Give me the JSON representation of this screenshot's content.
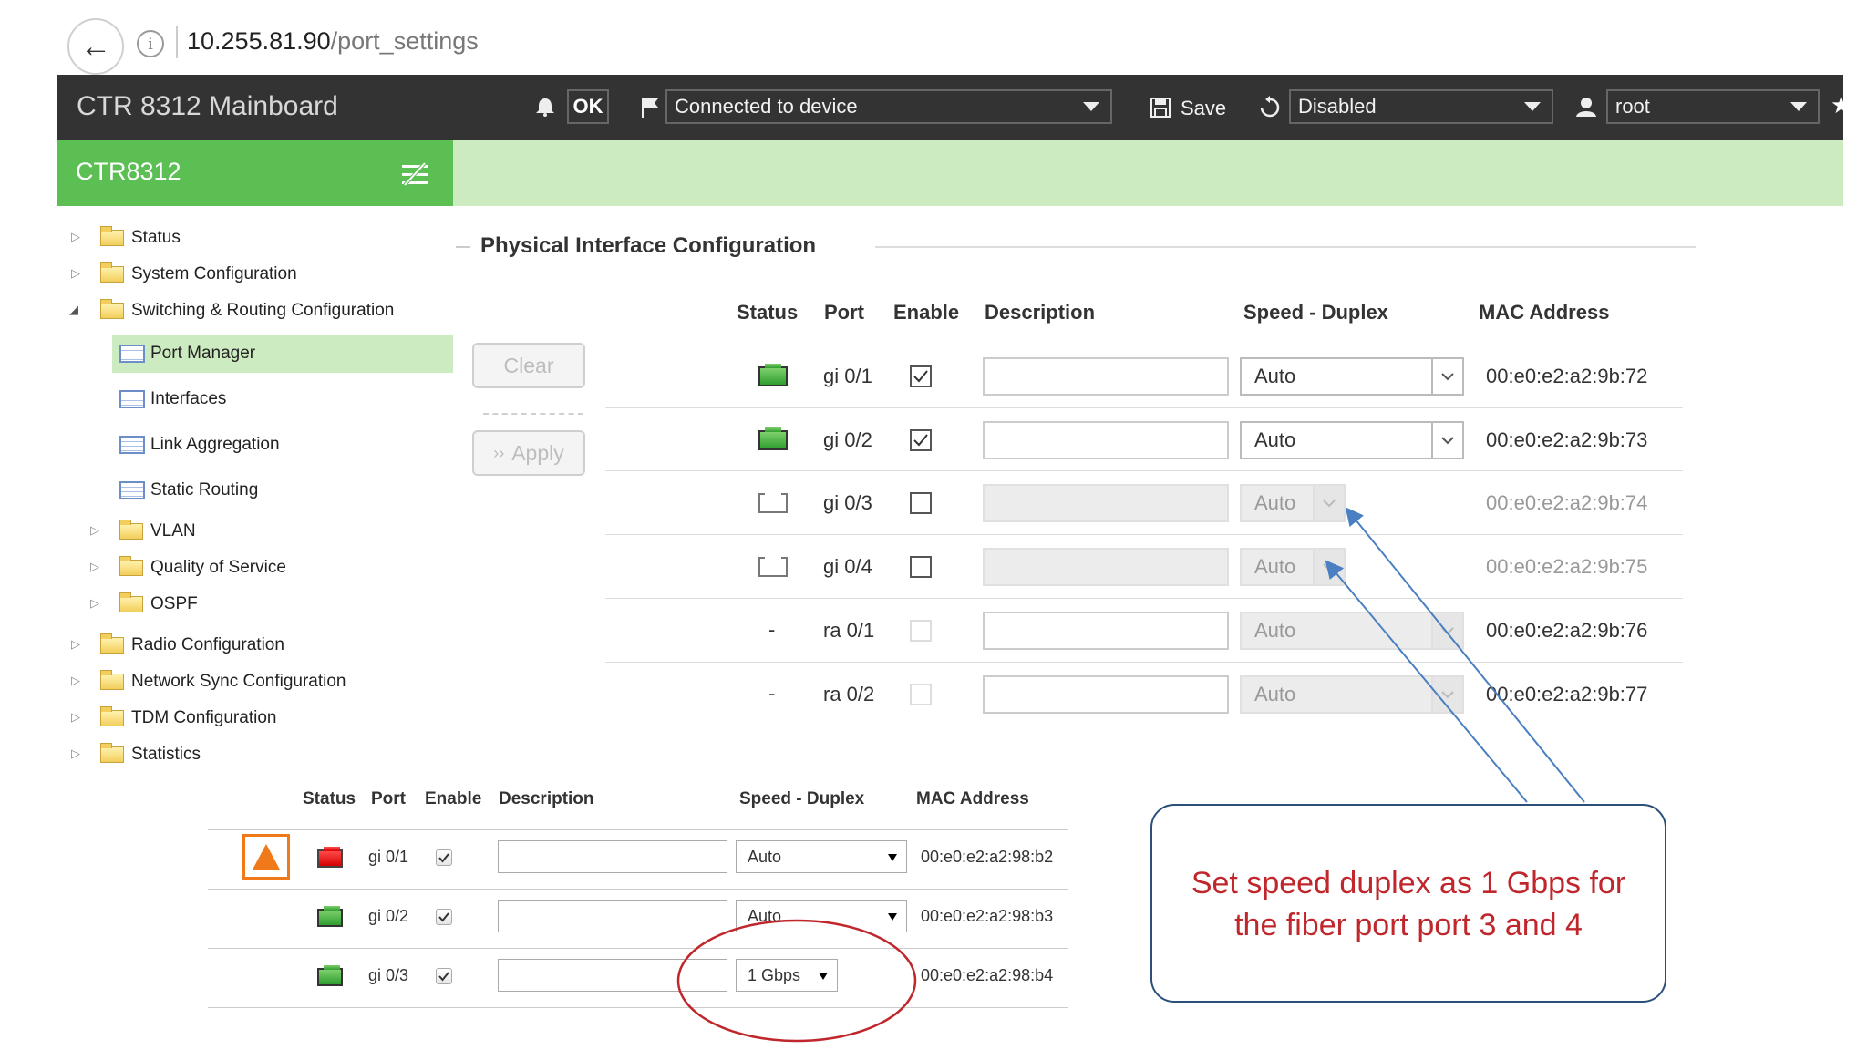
{
  "browser": {
    "url_host": "10.255.81.90",
    "url_path": "/port_settings"
  },
  "header": {
    "title": "CTR 8312 Mainboard",
    "ok_label": "OK",
    "connection_status": "Connected to device",
    "save_label": "Save",
    "auto_refresh": "Disabled",
    "user": "root"
  },
  "sidebar": {
    "title": "CTR8312",
    "items": [
      {
        "label": "Status"
      },
      {
        "label": "System Configuration"
      },
      {
        "label": "Switching & Routing Configuration"
      },
      {
        "label": "Port Manager"
      },
      {
        "label": "Interfaces"
      },
      {
        "label": "Link Aggregation"
      },
      {
        "label": "Static Routing"
      },
      {
        "label": "VLAN"
      },
      {
        "label": "Quality of Service"
      },
      {
        "label": "OSPF"
      },
      {
        "label": "Radio Configuration"
      },
      {
        "label": "Network Sync Configuration"
      },
      {
        "label": "TDM Configuration"
      },
      {
        "label": "Statistics"
      }
    ]
  },
  "main": {
    "section_title": "Physical Interface Configuration",
    "clear_label": "Clear",
    "apply_label": "Apply",
    "columns": [
      "Status",
      "Port",
      "Enable",
      "Description",
      "Speed - Duplex",
      "MAC Address"
    ],
    "rows": [
      {
        "status": "up",
        "status_text": "",
        "port": "gi 0/1",
        "enabled": true,
        "speed": "Auto",
        "mac": "00:e0:e2:a2:9b:72"
      },
      {
        "status": "up",
        "status_text": "",
        "port": "gi 0/2",
        "enabled": true,
        "speed": "Auto",
        "mac": "00:e0:e2:a2:9b:73"
      },
      {
        "status": "off",
        "status_text": "",
        "port": "gi 0/3",
        "enabled": false,
        "speed": "Auto",
        "mac": "00:e0:e2:a2:9b:74"
      },
      {
        "status": "off",
        "status_text": "",
        "port": "gi 0/4",
        "enabled": false,
        "speed": "Auto",
        "mac": "00:e0:e2:a2:9b:75"
      },
      {
        "status": "none",
        "status_text": "-",
        "port": "ra 0/1",
        "enabled": false,
        "speed": "Auto",
        "mac": "00:e0:e2:a2:9b:76"
      },
      {
        "status": "none",
        "status_text": "-",
        "port": "ra 0/2",
        "enabled": false,
        "speed": "Auto",
        "mac": "00:e0:e2:a2:9b:77"
      }
    ]
  },
  "inset": {
    "columns": [
      "Status",
      "Port",
      "Enable",
      "Description",
      "Speed - Duplex",
      "MAC Address"
    ],
    "rows": [
      {
        "status": "down",
        "port": "gi 0/1",
        "speed": "Auto",
        "mac": "00:e0:e2:a2:98:b2"
      },
      {
        "status": "up",
        "port": "gi 0/2",
        "speed": "Auto",
        "mac": "00:e0:e2:a2:98:b3"
      },
      {
        "status": "up",
        "port": "gi 0/3",
        "speed": "1 Gbps",
        "mac": "00:e0:e2:a2:98:b4"
      }
    ]
  },
  "callout": {
    "text": "Set speed duplex as 1 Gbps for the fiber port port 3 and 4"
  },
  "colors": {
    "header_bg": "#333333",
    "sidebar_header": "#5cbf54",
    "green_bar": "#cdebc0",
    "annotation_red": "#c0272d",
    "annotation_blue": "#4a7fc1"
  }
}
